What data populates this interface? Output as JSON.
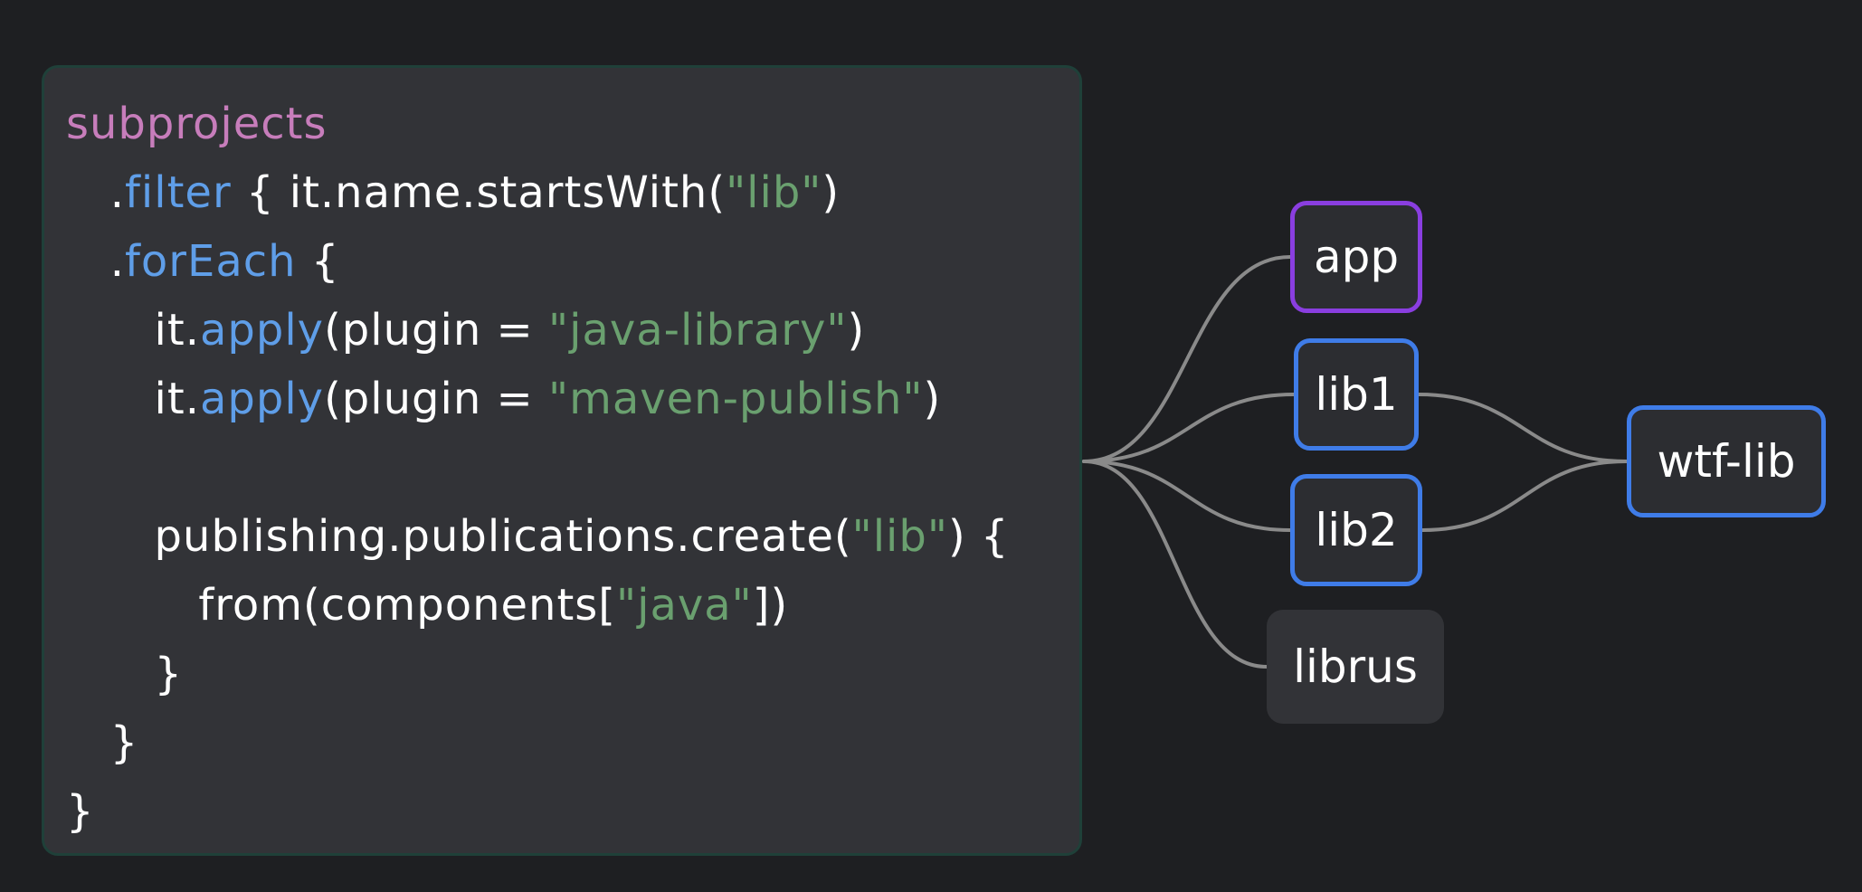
{
  "colors": {
    "background": "#1e1f22",
    "panel": "#323337",
    "panel_border": "#1f4039",
    "keyword": "#c77dbb",
    "function": "#5f9ee8",
    "string": "#6aa06f",
    "text": "#ffffff",
    "edge": "#8a8a8a",
    "node_purple": "#8a3ee0",
    "node_blue": "#3f7ce8"
  },
  "code": {
    "lines": [
      {
        "tokens": [
          {
            "t": "subprojects",
            "k": "kw"
          }
        ]
      },
      {
        "tokens": [
          {
            "t": "   .",
            "k": "plain"
          },
          {
            "t": "filter",
            "k": "fn"
          },
          {
            "t": " { it.name.startsWith(",
            "k": "plain"
          },
          {
            "t": "\"lib\"",
            "k": "str"
          },
          {
            "t": ")",
            "k": "plain"
          }
        ]
      },
      {
        "tokens": [
          {
            "t": "   .",
            "k": "plain"
          },
          {
            "t": "forEach",
            "k": "fn"
          },
          {
            "t": " {",
            "k": "plain"
          }
        ]
      },
      {
        "tokens": [
          {
            "t": "      it.",
            "k": "plain"
          },
          {
            "t": "apply",
            "k": "fn"
          },
          {
            "t": "(plugin = ",
            "k": "plain"
          },
          {
            "t": "\"java-library\"",
            "k": "str"
          },
          {
            "t": ")",
            "k": "plain"
          }
        ]
      },
      {
        "tokens": [
          {
            "t": "      it.",
            "k": "plain"
          },
          {
            "t": "apply",
            "k": "fn"
          },
          {
            "t": "(plugin = ",
            "k": "plain"
          },
          {
            "t": "\"maven-publish\"",
            "k": "str"
          },
          {
            "t": ")",
            "k": "plain"
          }
        ]
      },
      {
        "tokens": []
      },
      {
        "tokens": [
          {
            "t": "      publishing.publications.create(",
            "k": "plain"
          },
          {
            "t": "\"lib\"",
            "k": "str"
          },
          {
            "t": ") {",
            "k": "plain"
          }
        ]
      },
      {
        "tokens": [
          {
            "t": "         from(components[",
            "k": "plain"
          },
          {
            "t": "\"java\"",
            "k": "str"
          },
          {
            "t": "])",
            "k": "plain"
          }
        ]
      },
      {
        "tokens": [
          {
            "t": "      }",
            "k": "plain"
          }
        ]
      },
      {
        "tokens": [
          {
            "t": "   }",
            "k": "plain"
          }
        ]
      },
      {
        "tokens": [
          {
            "t": "}",
            "k": "plain"
          }
        ]
      }
    ]
  },
  "graph": {
    "nodes": [
      {
        "id": "app",
        "label": "app",
        "style": "purple"
      },
      {
        "id": "lib1",
        "label": "lib1",
        "style": "blue"
      },
      {
        "id": "lib2",
        "label": "lib2",
        "style": "blue"
      },
      {
        "id": "librus",
        "label": "librus",
        "style": "plain"
      },
      {
        "id": "wtf-lib",
        "label": "wtf-lib",
        "style": "blue"
      }
    ],
    "edges": [
      {
        "from": "panel",
        "to": "app"
      },
      {
        "from": "panel",
        "to": "lib1"
      },
      {
        "from": "panel",
        "to": "lib2"
      },
      {
        "from": "panel",
        "to": "librus"
      },
      {
        "from": "lib1",
        "to": "wtf-lib"
      },
      {
        "from": "lib2",
        "to": "wtf-lib"
      }
    ]
  }
}
